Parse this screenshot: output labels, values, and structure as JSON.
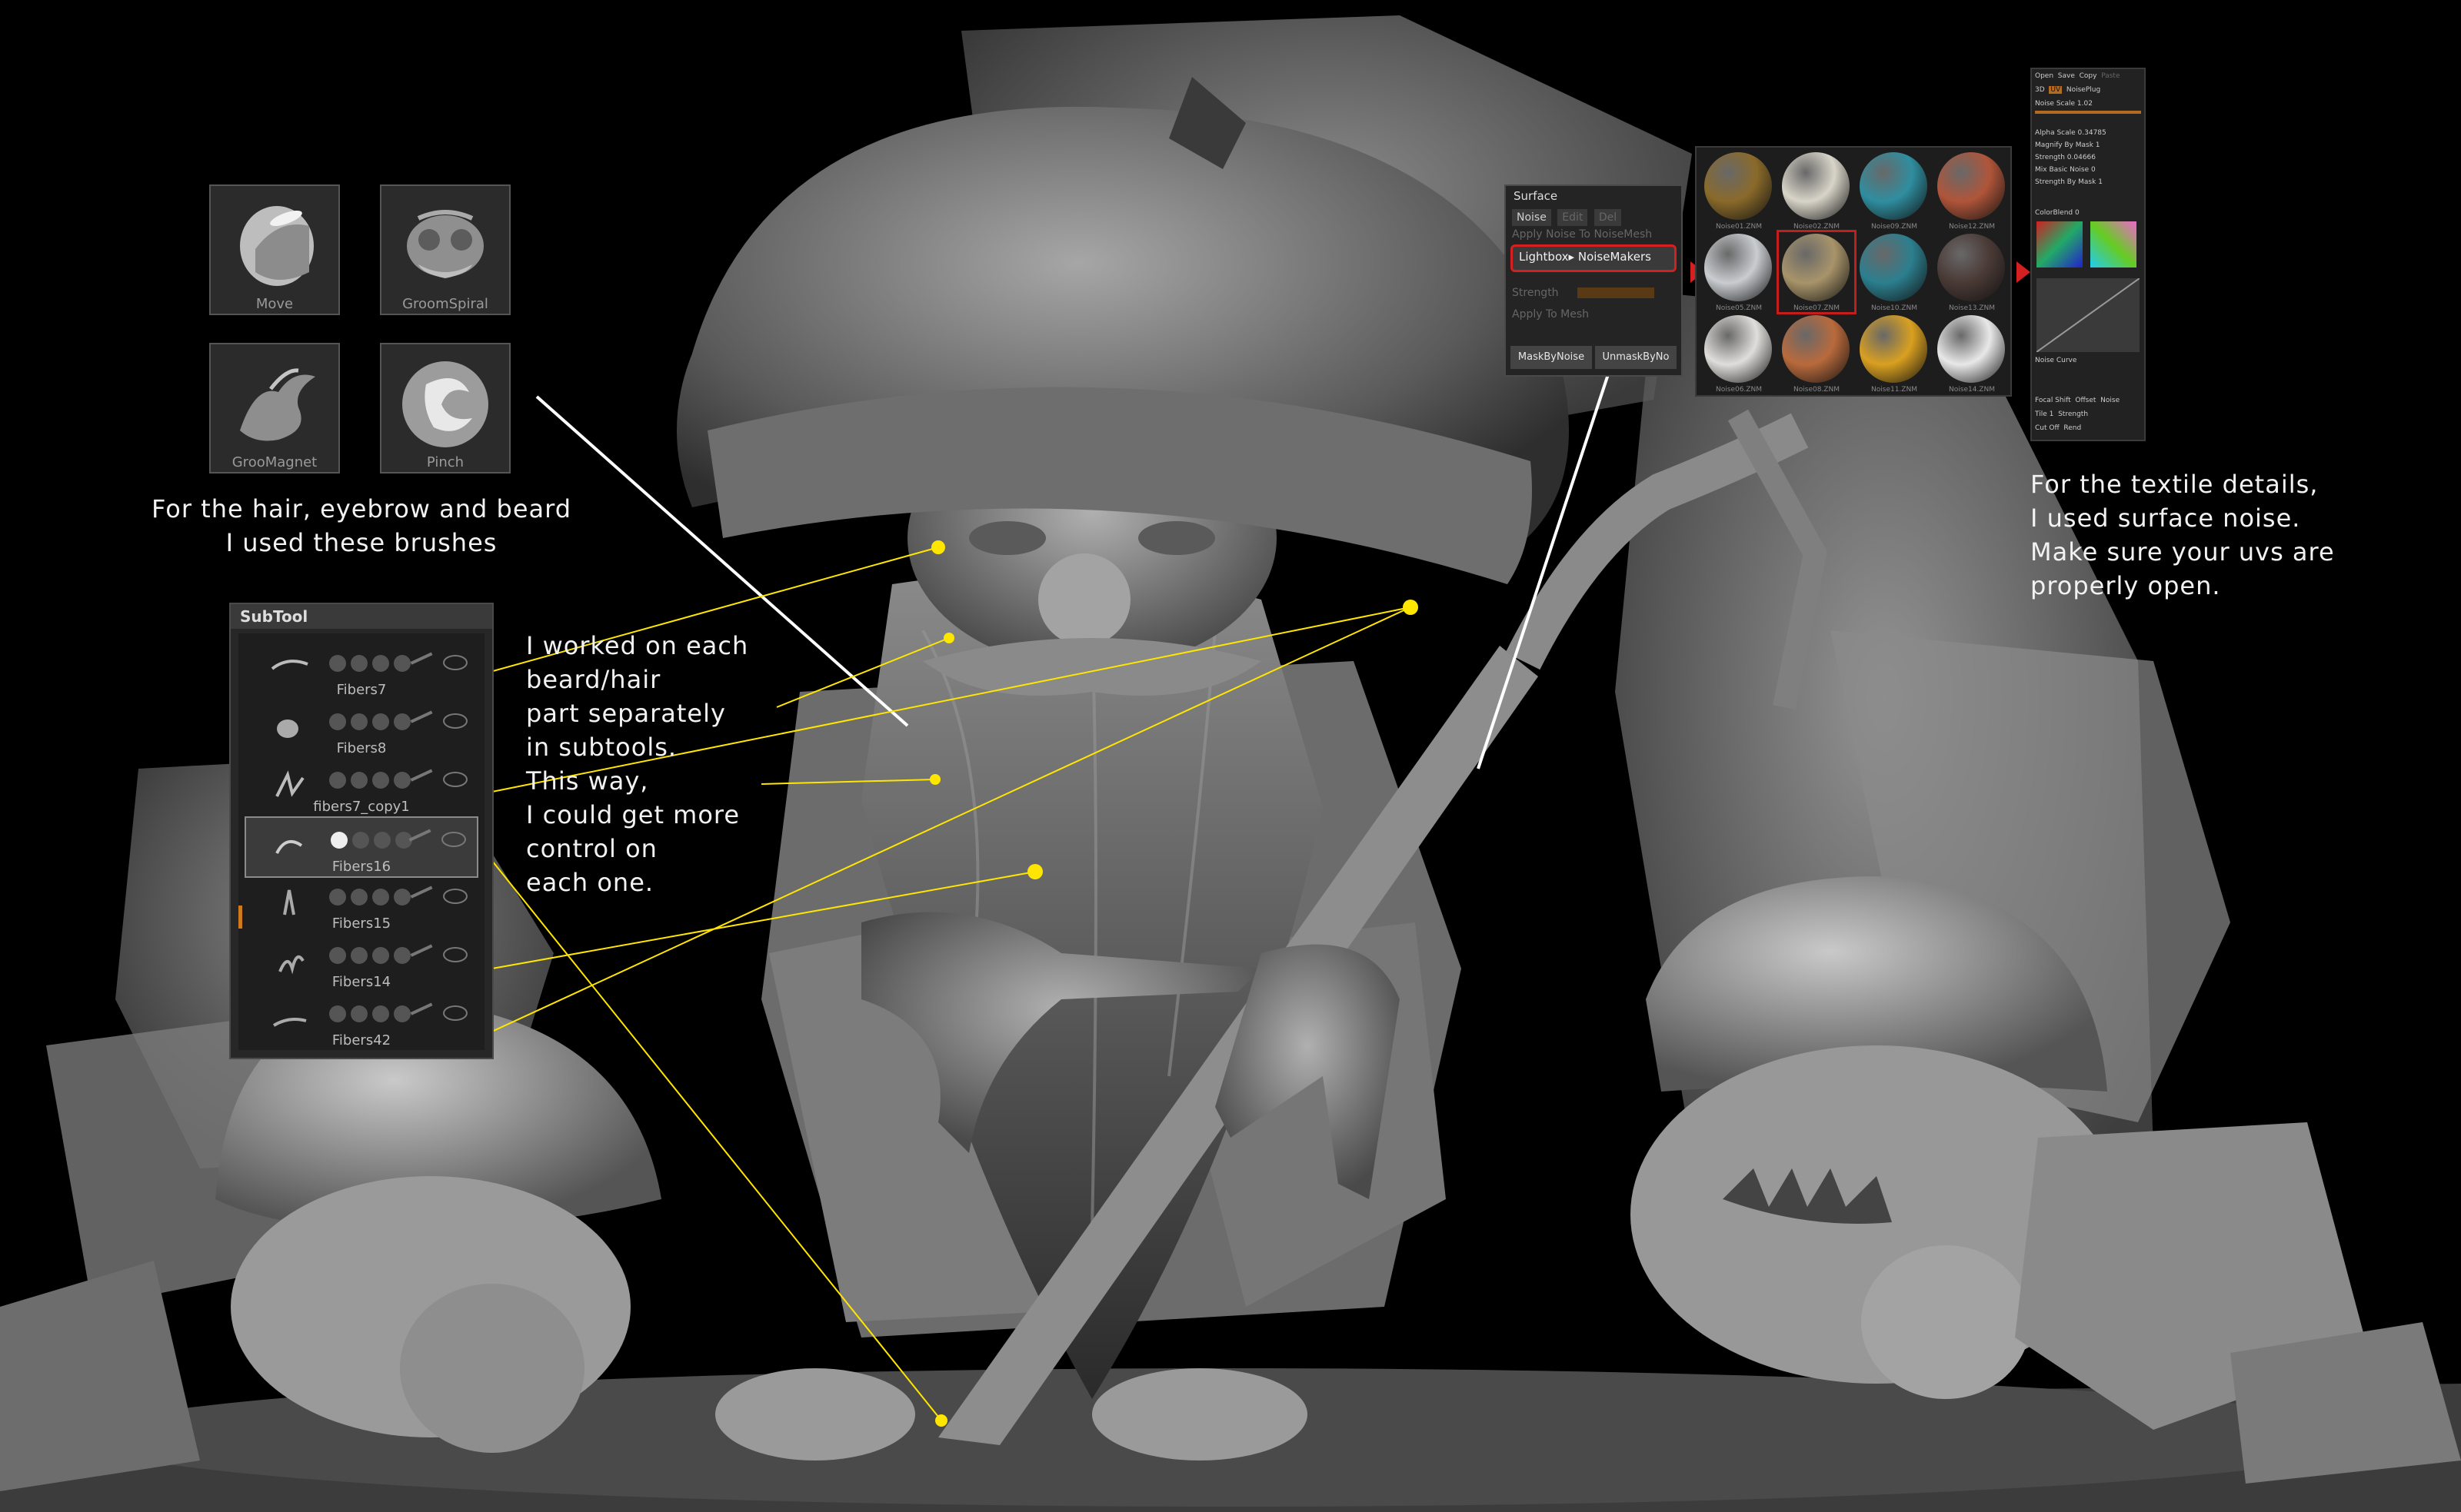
{
  "annotations": {
    "hair_brushes": [
      "For the hair, eyebrow and beard",
      "I used these brushes"
    ],
    "subtools": [
      "I worked on each",
      "beard/hair",
      "part separately",
      "in subtools.",
      "This way,",
      "I could get more",
      "control on",
      "each one."
    ],
    "textile": [
      "For the textile details,",
      "I used surface noise.",
      "Make sure your uvs are",
      "properly open."
    ]
  },
  "brushes": [
    {
      "label": "Move",
      "icon": "move-brush-icon"
    },
    {
      "label": "GroomSpiral",
      "icon": "groomspiral-brush-icon"
    },
    {
      "label": "GrooMagnet",
      "icon": "groommagnet-brush-icon"
    },
    {
      "label": "Pinch",
      "icon": "pinch-brush-icon"
    }
  ],
  "subtool_panel": {
    "title": "SubTool",
    "items": [
      {
        "name": "Fibers7",
        "active": false
      },
      {
        "name": "Fibers8",
        "active": false
      },
      {
        "name": "fibers7_copy1",
        "active": false
      },
      {
        "name": "Fibers16",
        "active": true
      },
      {
        "name": "Fibers15",
        "active": false
      },
      {
        "name": "Fibers14",
        "active": false
      },
      {
        "name": "Fibers42",
        "active": false
      }
    ]
  },
  "surface_panel": {
    "title": "Surface",
    "noise": "Noise",
    "edit": "Edit",
    "del": "Del",
    "apply_noise_nm": "Apply Noise To NoiseMesh",
    "lightbox": "Lightbox▸ NoiseMakers",
    "strength_label": "Strength",
    "apply_to_mesh": "Apply To Mesh",
    "mask_by_noise": "MaskByNoise",
    "unmask_by_noise": "UnmaskByNo"
  },
  "noise_grid": [
    {
      "label": "Noise01.ZNM",
      "color": "#8a6a2a"
    },
    {
      "label": "Noise02.ZNM",
      "color": "#d8d4c8"
    },
    {
      "label": "Noise09.ZNM",
      "color": "#2f8ea0"
    },
    {
      "label": "Noise12.ZNM",
      "color": "#b0553a"
    },
    {
      "label": "Noise05.ZNM",
      "color": "#c9ccd0"
    },
    {
      "label": "Noise07.ZNM",
      "color": "#a8946a"
    },
    {
      "label": "Noise10.ZNM",
      "color": "#2c7f8f"
    },
    {
      "label": "Noise13.ZNM",
      "color": "#4a3a36"
    },
    {
      "label": "Noise06.ZNM",
      "color": "#e0dedb"
    },
    {
      "label": "Noise08.ZNM",
      "color": "#b96a3c"
    },
    {
      "label": "Noise11.ZNM",
      "color": "#d9a020"
    },
    {
      "label": "Noise14.ZNM",
      "color": "#e8e8e8"
    }
  ],
  "noisemaker_panel": {
    "buttons": [
      "Open",
      "Save",
      "Copy",
      "Paste"
    ],
    "mode": [
      "3D",
      "UV",
      "NoisePlug"
    ],
    "rows": [
      "Noise Scale 1.02",
      "Alpha Scale 0.34785",
      "Magnify By Mask 1",
      "Strength 0.04666",
      "Mix Basic Noise 0",
      "Strength By Mask 1",
      "ColorBlend 0",
      "Noise Curve",
      "Focal Shift",
      "Offset",
      "Noise",
      "Tile 1",
      "Strength",
      "Cut Off",
      "Rend"
    ]
  },
  "colors": {
    "accent_yellow": "#ffe600",
    "highlight_red": "#d42020",
    "slider_orange": "#b46a20"
  }
}
